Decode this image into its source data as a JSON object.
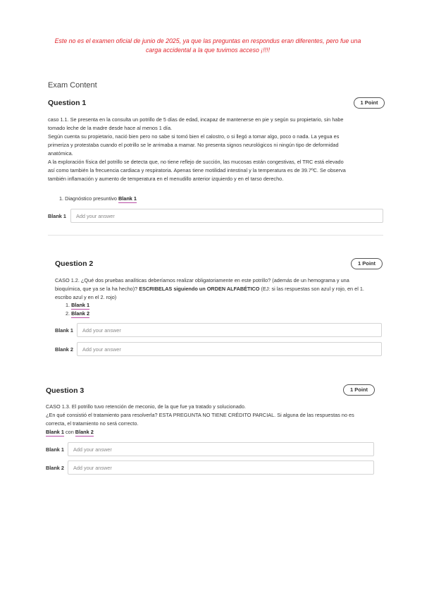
{
  "notice": "Este no es el examen oficial de junio de 2025, ya que las preguntas en respondus eran diferentes, pero fue una\ncarga accidental a la que tuvimos acceso ¡!!!!",
  "exam_heading": "Exam Content",
  "q1": {
    "title": "Question 1",
    "points": "1 Point",
    "lines": [
      "caso 1.1. Se presenta en la consulta un potrillo de 5 días de edad, incapaz de mantenerse en pie y según su propietario, sin habe",
      "tomado leche de la madre desde hace al menos 1 día.",
      "Según cuenta su propietario, nació bien pero no sabe si tomó bien el calostro, o si llegó a tomar algo, poco o nada. La yegua es",
      "primeriza y protestaba cuando el potrillo se le arrimaba a mamar. No presenta signos neurológicos ni ningún tipo de deformidad",
      "anatómica.",
      "A la exploración física del potrillo se detecta que, no tiene reflejo de succión, las mucosas están congestivas, el TRC está elevado",
      "así como también la frecuencia cardiaca y respiratoria. Apenas tiene motilidad intestinal y la temperatura es de 39.7ºC. Se observa",
      "también inflamación y aumento de temperatura en el menudillo anterior izquierdo y en el tarso derecho."
    ],
    "item_prefix": "1. Diagnóstico presuntivo ",
    "item_blank": "Blank 1",
    "blank_label": "Blank 1",
    "placeholder": "Add your answer"
  },
  "q2": {
    "title": "Question 2",
    "points": "1 Point",
    "line1": "CASO 1.2. ¿Qué dos pruebas analíticas deberíamos realizar obligatoriamente en este potrillo? (además de un hemograma y una",
    "line2_pre": "bioquímica, que ya se la ha hecho)? ",
    "line2_bold": "ESCRIBELAS siguiendo un ORDEN ALFABÉTICO",
    "line2_post": " (EJ: si las respuestas son azul y rojo, en el 1.",
    "line3": "escribo azul y en el 2. rojo)",
    "item1_num": "1.",
    "item1": "Blank 1",
    "item2_num": "2.",
    "item2": "Blank 2",
    "blank1_label": "Blank 1",
    "blank2_label": "Blank 2",
    "placeholder": "Add your answer"
  },
  "q3": {
    "title": "Question 3",
    "points": "1 Point",
    "lines": [
      "CASO 1.3. El potrillo tuvo retención de meconio, de la que fue ya tratado y solucionado.",
      "¿En qué consistió el tratamiento para resolverla? ESTA PREGUNTA NO TIENE CRÉDITO PARCIAL. Si alguna de las respuestas no es",
      "correcta, el tratamiento no será correcto."
    ],
    "ref1": "Blank 1",
    "con": " con ",
    "ref2": "Blank 2",
    "blank1_label": "Blank 1",
    "blank2_label": "Blank 2",
    "placeholder": "Add your answer"
  }
}
